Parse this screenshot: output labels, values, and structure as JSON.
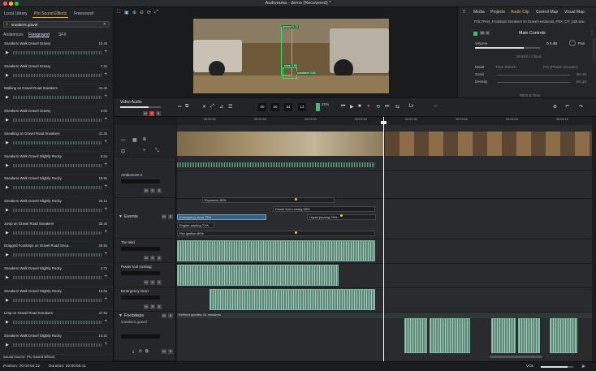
{
  "app": {
    "title": "Audiorama - demo (Recovered) *"
  },
  "browser": {
    "tabs": [
      "Local Library",
      "Pro Sound Effects",
      "Freesound"
    ],
    "active_tab": "Pro Sound Effects",
    "search_value": "sneakers gravel",
    "subtabs": [
      "Ambiences",
      "Foreground",
      "SFX"
    ],
    "active_subtab": "Foreground",
    "items": [
      {
        "name": "Sneakers Walk Gravel Grassy",
        "dur": "10.4s"
      },
      {
        "name": "Sneakers Walk Gravel Grassy",
        "dur": "7.2s"
      },
      {
        "name": "Walking on Gravel Road Sneakers",
        "dur": "41.4s"
      },
      {
        "name": "Sneakers Walk Gravel Grassy",
        "dur": "4.0s"
      },
      {
        "name": "Sneaking on Gravel Road Sneakers",
        "dur": "41.3s"
      },
      {
        "name": "Sneakers Walk Gravel Slightly Rocky",
        "dur": "5.5s"
      },
      {
        "name": "Sneakers Walk Gravel Slightly Rocky",
        "dur": "18.9s"
      },
      {
        "name": "Sneakers Walk Gravel Slightly Rocky",
        "dur": "25.1s"
      },
      {
        "name": "Jump on Gravel Road Sneakers",
        "dur": "26.4s"
      },
      {
        "name": "Dragged Footsteps on Gravel Road Snea...",
        "dur": "30.5s"
      },
      {
        "name": "Sneakers Walk Gravel Slightly Rocky",
        "dur": "4.7s"
      },
      {
        "name": "Sneakers Walk Gravel Slightly Rocky",
        "dur": "13.0s"
      },
      {
        "name": "Limp on Gravel Road Sneakers",
        "dur": "37.5s"
      },
      {
        "name": "Sneakers Walk Gravel Slightly Rocky",
        "dur": "14.2s"
      }
    ],
    "source_note": "Sound source: Pro Sound Effects"
  },
  "video": {
    "labels": [
      "truck 0.81",
      "person 0.72",
      "sneakers 0.64",
      "shoe 0.58"
    ]
  },
  "inspector": {
    "tabs": [
      "Media",
      "Projects",
      "Audio Clip",
      "Control Map",
      "Visual Map"
    ],
    "active_tab": "Audio Clip",
    "file": "POLYFeet_Footsteps Sneakers on Gravel Hardwood_PSX_CP_Up0.wav",
    "main_control": "Main Controls",
    "volume_label": "Volume",
    "volume_value": "0.0 dB",
    "pan_label": "Pan",
    "stretch_cloud": "Stretch / Cloud",
    "mode_label": "Mode",
    "mode_value": "Time Stretch",
    "engine_value": "Pro (Phase Vocoder)",
    "grain_label": "Grain",
    "grain_value": "60 ms",
    "density_label": "Density",
    "density_value": "80 g/s",
    "pitch_time": "Pitch & Time"
  },
  "transport": {
    "video_audio": "Video Audio",
    "time_labels": [
      "HOURS",
      "MINUTES",
      "SECONDS",
      "FRAMES"
    ],
    "time_values": [
      "00",
      "00",
      "54",
      "13"
    ],
    "cpu": "22%",
    "zoom": "1x"
  },
  "ruler": {
    "marks": [
      "00:02:30",
      "00:02:45",
      "00:03:00",
      "00:03:15",
      "00:03:30",
      "00:03:45",
      "00:04:00",
      "00:04:15"
    ]
  },
  "tracks": [
    {
      "name": "Ambiences 3",
      "type": "audio"
    },
    {
      "name": "Events",
      "type": "group"
    },
    {
      "name": "Tire skid",
      "type": "audio"
    },
    {
      "name": "Power tool running",
      "type": "audio"
    },
    {
      "name": "Emergency siren",
      "type": "audio"
    },
    {
      "name": "Footsteps",
      "type": "group",
      "prompt": "sneakers gravel",
      "refine": "Refined queries: 51 sneakers"
    }
  ],
  "events": [
    {
      "label": "Explosion 80%"
    },
    {
      "label": "Power tool running 65%"
    },
    {
      "label": "Emergency siren 78%"
    },
    {
      "label": "Liquid pouring 76%"
    },
    {
      "label": "Engine starting 71%"
    },
    {
      "label": "Fire ignition 80%"
    }
  ],
  "status": {
    "position": "Position: 00:00:54:22",
    "duration": "Duration: 00:00:56:11",
    "vol": "VOL"
  }
}
